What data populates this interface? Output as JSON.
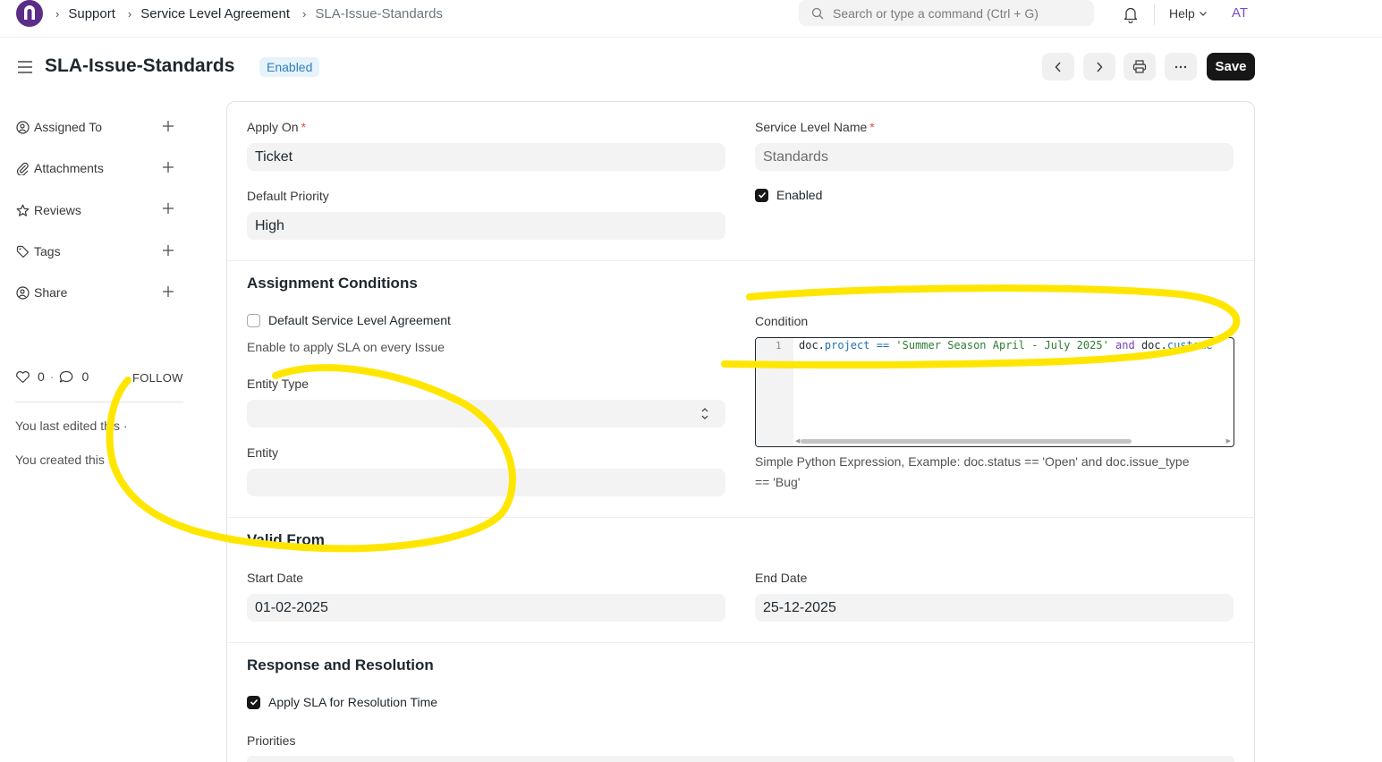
{
  "navbar": {
    "breadcrumbs": [
      "Support",
      "Service Level Agreement",
      "SLA-Issue-Standards"
    ],
    "search_placeholder": "Search or type a command (Ctrl + G)",
    "help_label": "Help",
    "user_initials": "AT"
  },
  "header": {
    "title": "SLA-Issue-Standards",
    "status": "Enabled",
    "save_label": "Save"
  },
  "sidebar": {
    "items": [
      {
        "label": "Assigned To",
        "icon": "user-assign-icon"
      },
      {
        "label": "Attachments",
        "icon": "paperclip-icon"
      },
      {
        "label": "Reviews",
        "icon": "star-icon"
      },
      {
        "label": "Tags",
        "icon": "tag-icon"
      },
      {
        "label": "Share",
        "icon": "share-user-icon"
      }
    ],
    "likes": "0",
    "comments": "0",
    "follow_label": "FOLLOW",
    "last_edited": "You last edited this ·",
    "created": "You created this ·"
  },
  "form": {
    "apply_on": {
      "label": "Apply On",
      "value": "Ticket"
    },
    "service_level_name": {
      "label": "Service Level Name",
      "value": "Standards"
    },
    "default_priority": {
      "label": "Default Priority",
      "value": "High"
    },
    "enabled": {
      "label": "Enabled",
      "checked": true
    },
    "assignment_section": "Assignment Conditions",
    "default_sla": {
      "label": "Default Service Level Agreement",
      "checked": false,
      "description": "Enable to apply SLA on every Issue"
    },
    "entity_type": {
      "label": "Entity Type",
      "value": ""
    },
    "entity": {
      "label": "Entity",
      "value": ""
    },
    "condition": {
      "label": "Condition",
      "line_number": "1",
      "code_tokens": [
        {
          "t": "doc.",
          "c": ""
        },
        {
          "t": "project",
          "c": "prop"
        },
        {
          "t": " == ",
          "c": "op"
        },
        {
          "t": "'Summer Season April - July 2025'",
          "c": "str"
        },
        {
          "t": " ",
          "c": ""
        },
        {
          "t": "and",
          "c": "kw"
        },
        {
          "t": " doc.",
          "c": ""
        },
        {
          "t": "custome",
          "c": "prop"
        }
      ],
      "help_line1": "Simple Python Expression, Example: doc.status == 'Open' and doc.issue_type",
      "help_line2": "== 'Bug'"
    },
    "valid_from_section": "Valid From",
    "start_date": {
      "label": "Start Date",
      "value": "01-02-2025"
    },
    "end_date": {
      "label": "End Date",
      "value": "25-12-2025"
    },
    "response_section": "Response and Resolution",
    "apply_sla_resolution": {
      "label": "Apply SLA for Resolution Time",
      "checked": true
    },
    "priorities_label": "Priorities"
  },
  "colors": {
    "annotation": "#ffe600",
    "accent": "#171717",
    "status_bg": "#e6f3fb",
    "status_text": "#2f7ec2"
  }
}
